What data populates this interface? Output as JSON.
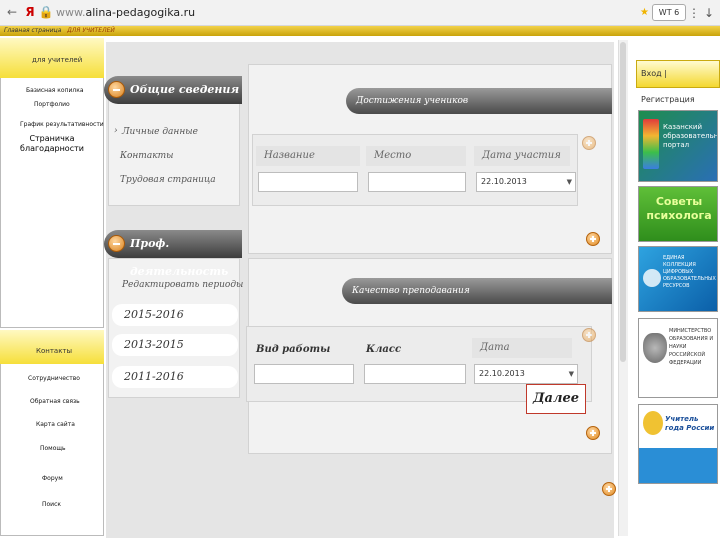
{
  "browser": {
    "nav_back": "←",
    "nav_yandex": "Я",
    "address_prefix": "www.",
    "address_domain": "alina-pedagogika.ru",
    "extension_label": "WT 6",
    "menu_dots": "⋮",
    "download": "↓"
  },
  "breadcrumbs": {
    "home": "Главная страница",
    "current": "ДЛЯ УЧИТЕЛЕЙ"
  },
  "left_menu": {
    "title": "для учителей",
    "items": [
      "Базисная копилка",
      "Портфолио",
      "График результативности"
    ],
    "annotation": "Страничка благодарности",
    "section2_title": "Контакты",
    "section2_items": [
      "Сотрудничество",
      "Обратная связь",
      "Карта сайта",
      "Помощь",
      "Форум",
      "Поиск"
    ]
  },
  "content": {
    "general_tab": "Общие сведения",
    "general_items": [
      "Личные данные",
      "Контакты",
      "Трудовая страница"
    ],
    "prof_tab": "Проф. деятельность",
    "period_label": "Редактировать периоды",
    "periods": [
      "2015-2016",
      "2013-2015",
      "2011-2016"
    ],
    "achievements_tab": "Достижения учеников",
    "achievements_cols": [
      "Название",
      "Место",
      "Дата участия"
    ],
    "achievements_date": "22.10.2013",
    "quality_tab": "Качество преподавания",
    "quality_cols": [
      "Вид работы",
      "Класс",
      "Дата"
    ],
    "quality_date": "22.10.2013",
    "next_button": "Далее"
  },
  "right_panel": {
    "login_label": "Вход | Регистрация",
    "banner_kazan": "Казанский образовательный портал",
    "banner_advice": "Советы психолога",
    "banner_digital": "ЕДИНАЯ КОЛЛЕКЦИЯ ЦИФРОВЫХ ОБРАЗОВАТЕЛЬНЫХ РЕСУРСОВ",
    "banner_ministry": "МИНИСТЕРСТВО ОБРАЗОВАНИЯ И НАУКИ РОССИЙСКОЙ ФЕДЕРАЦИИ",
    "banner_teacher": "Учитель года России"
  },
  "colors": {
    "accent_yellow": "#f6df3a",
    "tab_dark": "#3d3d3d",
    "orange_icon": "#e0891f",
    "highlight_red": "#c0392b"
  }
}
